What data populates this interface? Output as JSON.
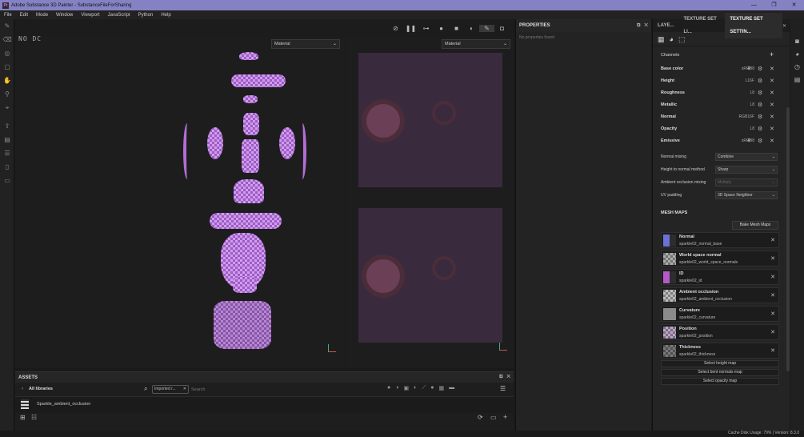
{
  "app": {
    "title": "Adobe Substance 3D Painter - SubstanceFileForSharing",
    "logo": "Pt"
  },
  "menu": [
    "File",
    "Edit",
    "Mode",
    "Window",
    "Viewport",
    "JavaScript",
    "Python",
    "Help"
  ],
  "viewport": {
    "hud": "NO DC",
    "left_mode": "Material",
    "right_mode": "Material"
  },
  "properties": {
    "title": "PROPERTIES",
    "empty": "No properties found"
  },
  "tabs": [
    "LAYE...",
    "TEXTURE SET LI...",
    "TEXTURE SET SETTIN..."
  ],
  "channels": {
    "title": "Channels",
    "items": [
      {
        "name": "Base color",
        "format": "sRGB8"
      },
      {
        "name": "Height",
        "format": "L16F"
      },
      {
        "name": "Roughness",
        "format": "L8"
      },
      {
        "name": "Metallic",
        "format": "L8"
      },
      {
        "name": "Normal",
        "format": "RGB16F"
      },
      {
        "name": "Opacity",
        "format": "L8"
      },
      {
        "name": "Emissive",
        "format": "sRGB8"
      }
    ]
  },
  "settings": [
    {
      "label": "Normal mixing",
      "value": "Combine",
      "disabled": false
    },
    {
      "label": "Height to normal method",
      "value": "Sharp",
      "disabled": false
    },
    {
      "label": "Ambient occlusion mixing",
      "value": "Multiply",
      "disabled": true
    },
    {
      "label": "UV padding",
      "value": "3D Space Neighbor",
      "disabled": false
    }
  ],
  "mesh_maps": {
    "title": "MESH MAPS",
    "bake_button": "Bake Mesh Maps",
    "items": [
      {
        "name": "Normal",
        "file": "sparkle02_normal_base",
        "thumb": "#6a72d8"
      },
      {
        "name": "World space normal",
        "file": "sparkle02_world_space_normals",
        "thumb": "#6a6a6a"
      },
      {
        "name": "ID",
        "file": "sparkle02_id",
        "thumb": "#b45ac8"
      },
      {
        "name": "Ambient occlusion",
        "file": "sparkle02_ambient_occlusion",
        "thumb": "#777777"
      },
      {
        "name": "Curvature",
        "file": "sparkle02_curvature",
        "thumb": "#8a8a8a"
      },
      {
        "name": "Position",
        "file": "sparkle02_position",
        "thumb": "#8a6a8a"
      },
      {
        "name": "Thickness",
        "file": "sparkle02_thickness",
        "thumb": "#5a5a5a"
      }
    ],
    "select_buttons": [
      "Select height map",
      "Select bent normals map",
      "Select opacity map"
    ]
  },
  "assets": {
    "title": "ASSETS",
    "library": "All libraries",
    "filter_tag": "Imported r...",
    "search_placeholder": "Search",
    "item": "Sparkle_ambient_occlusion"
  },
  "status": {
    "text": "Cache Disk Usage:  79% | Version: 8.3.0"
  }
}
